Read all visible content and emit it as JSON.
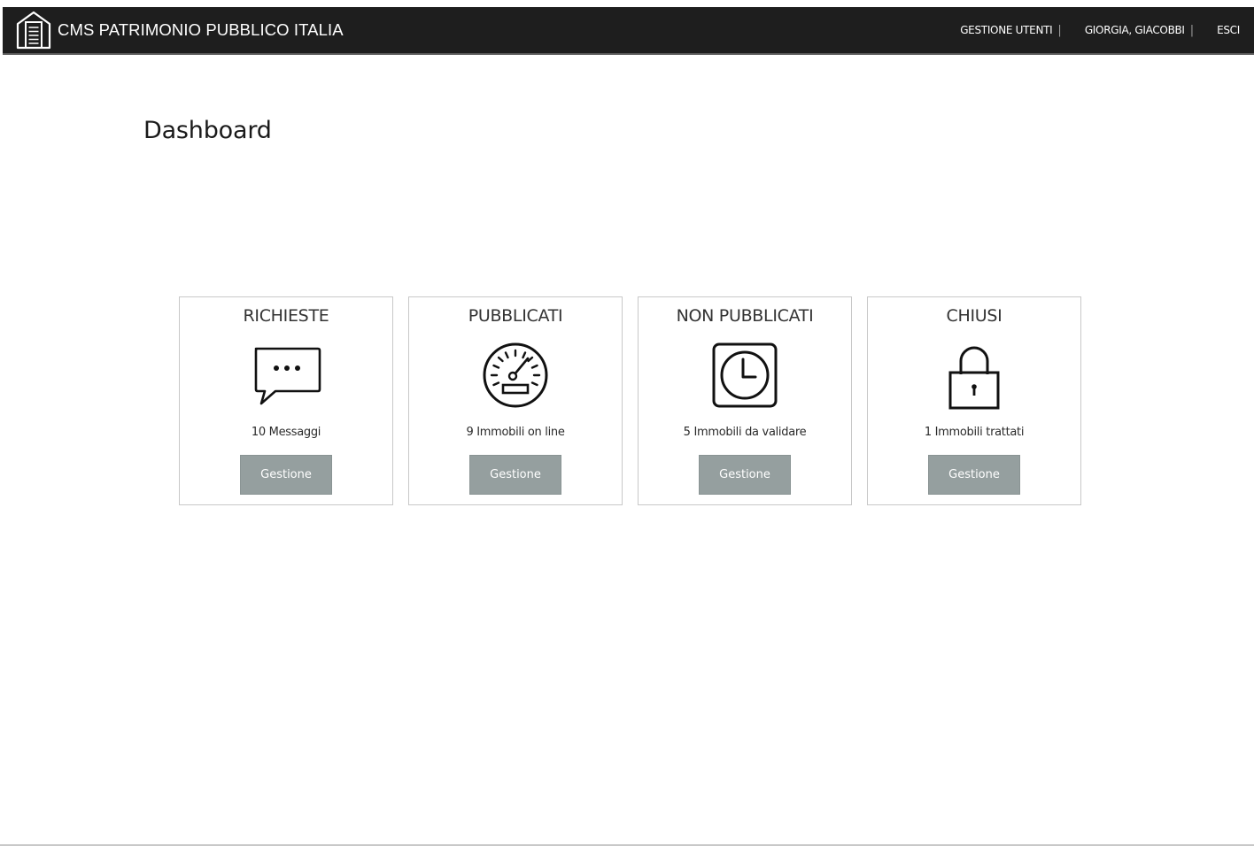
{
  "header": {
    "brand_title": "CMS PATRIMONIO PUBBLICO ITALIA",
    "logo_icon": "building-document-icon",
    "background_color": "#1e1e1e",
    "nav": {
      "users_label": "GESTIONE UTENTI",
      "user_name": "GIORGIA, GIACOBBI",
      "logout_label": "ESCI",
      "separator": "|"
    }
  },
  "main": {
    "title": "Dashboard",
    "cards": [
      {
        "title": "RICHIESTE",
        "icon": "chat-bubble-icon",
        "count_text": "10 Messaggi",
        "button_label": "Gestione"
      },
      {
        "title": "PUBBLICATI",
        "icon": "speedometer-icon",
        "count_text": "9 Immobili on line",
        "button_label": "Gestione"
      },
      {
        "title": "NON PUBBLICATI",
        "icon": "clock-icon",
        "count_text": "5 Immobili da validare",
        "button_label": "Gestione"
      },
      {
        "title": "CHIUSI",
        "icon": "padlock-icon",
        "count_text": "1 Immobili trattati",
        "button_label": "Gestione"
      }
    ],
    "button_color": "#959f9f"
  }
}
